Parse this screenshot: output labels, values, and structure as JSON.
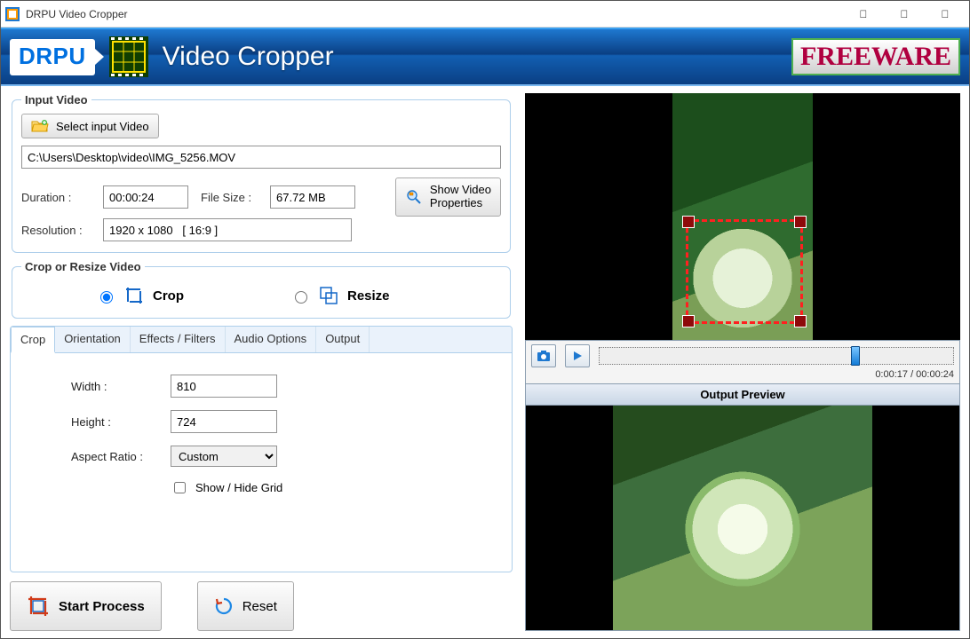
{
  "window_title": "DRPU Video Cropper",
  "header": {
    "brand": "DRPU",
    "title": "Video Cropper",
    "freeware": "FREEWARE"
  },
  "input_group": {
    "legend": "Input Video",
    "select_button": "Select input Video",
    "path": "C:\\Users\\Desktop\\video\\IMG_5256.MOV",
    "duration_label": "Duration :",
    "duration": "00:00:24",
    "filesize_label": "File Size :",
    "filesize": "67.72 MB",
    "resolution_label": "Resolution :",
    "resolution": "1920 x 1080   [ 16:9 ]",
    "show_props": "Show Video Properties"
  },
  "mode_group": {
    "legend": "Crop or Resize Video",
    "crop": "Crop",
    "resize": "Resize"
  },
  "tabs": {
    "crop": "Crop",
    "orientation": "Orientation",
    "effects": "Effects / Filters",
    "audio": "Audio Options",
    "output": "Output"
  },
  "crop_panel": {
    "width_label": "Width :",
    "width": "810",
    "height_label": "Height :",
    "height": "724",
    "aspect_label": "Aspect Ratio :",
    "aspect": "Custom",
    "show_grid": "Show / Hide Grid"
  },
  "actions": {
    "start": "Start Process",
    "reset": "Reset"
  },
  "timeline": {
    "position_pct": 71,
    "time": "0:00:17 / 00:00:24"
  },
  "output_preview_title": "Output Preview"
}
